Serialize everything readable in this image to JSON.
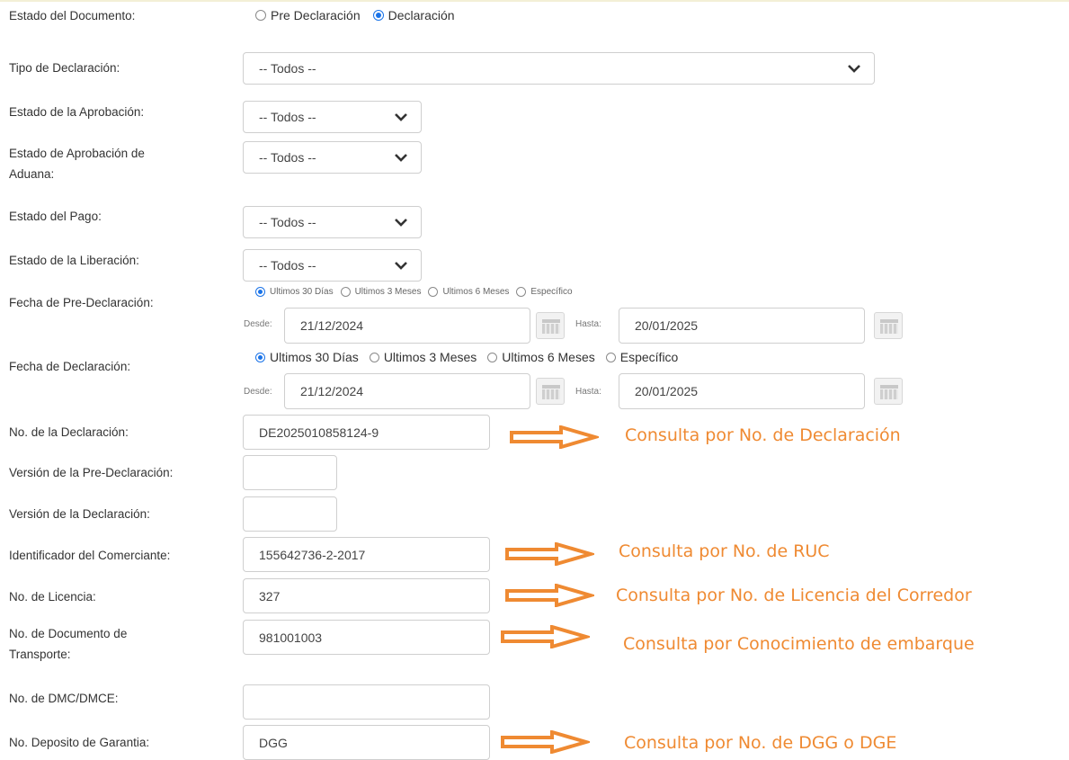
{
  "fields": {
    "estado_documento": {
      "label": "Estado del Documento:",
      "options": [
        "Pre Declaración",
        "Declaración"
      ],
      "selected": "Declaración"
    },
    "tipo_declaracion": {
      "label": "Tipo de Declaración:",
      "value": "-- Todos --"
    },
    "estado_aprobacion": {
      "label": "Estado de la Aprobación:",
      "value": "-- Todos --"
    },
    "estado_aprobacion_aduana": {
      "label_line1": "Estado de Aprobación de",
      "label_line2": "Aduana:",
      "value": "-- Todos --"
    },
    "estado_pago": {
      "label": "Estado del Pago:",
      "value": "-- Todos --"
    },
    "estado_liberacion": {
      "label": "Estado de la Liberación:",
      "value": "-- Todos --"
    },
    "fecha_pre_declaracion": {
      "label": "Fecha de Pre-Declaración:",
      "options": [
        "Ultimos 30 Días",
        "Ultimos 3 Meses",
        "Ultimos 6 Meses",
        "Específico"
      ],
      "selected": "Ultimos 30 Días",
      "desde_label": "Desde:",
      "desde": "21/12/2024",
      "hasta_label": "Hasta:",
      "hasta": "20/01/2025"
    },
    "fecha_declaracion": {
      "label": "Fecha de Declaración:",
      "options": [
        "Ultimos 30 Días",
        "Ultimos 3 Meses",
        "Ultimos 6 Meses",
        "Específico"
      ],
      "selected": "Ultimos 30 Días",
      "desde_label": "Desde:",
      "desde": "21/12/2024",
      "hasta_label": "Hasta:",
      "hasta": "20/01/2025"
    },
    "no_declaracion": {
      "label": "No. de la Declaración:",
      "value": "DE2025010858124-9"
    },
    "version_pre_declaracion": {
      "label": "Versión de la Pre-Declaración:",
      "value": ""
    },
    "version_declaracion": {
      "label": "Versión de la Declaración:",
      "value": ""
    },
    "identificador_comerciante": {
      "label": "Identificador del Comerciante:",
      "value": "155642736-2-2017"
    },
    "no_licencia": {
      "label": "No. de Licencia:",
      "value": "327"
    },
    "no_documento_transporte": {
      "label_line1": "No. de Documento de",
      "label_line2": "Transporte:",
      "value": "981001003"
    },
    "no_dmc": {
      "label": "No. de DMC/DMCE:",
      "value": ""
    },
    "no_deposito_garantia": {
      "label": "No. Deposito de Garantia:",
      "value": "DGG"
    }
  },
  "annotations": {
    "declaracion": "Consulta por No. de Declaración",
    "ruc": "Consulta por No. de RUC",
    "licencia": "Consulta por No. de Licencia del Corredor",
    "conocimiento": "Consulta por Conocimiento de embarque",
    "dgg": "Consulta por No. de DGG o DGE"
  },
  "colors": {
    "annotation": "#ef8a32",
    "radio_selected": "#1a73e8"
  }
}
